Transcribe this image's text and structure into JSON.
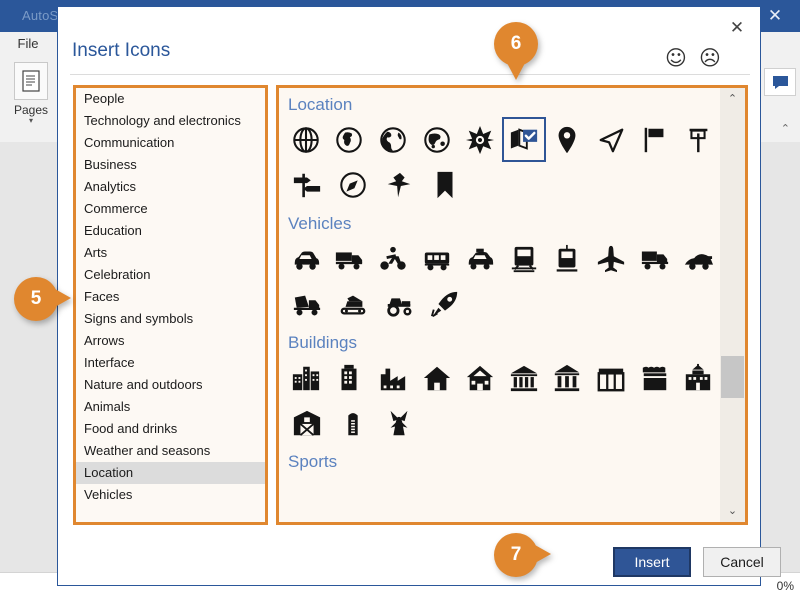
{
  "app": {
    "autosave_label": "AutoSave",
    "file_tab": "File",
    "pages_label": "Pages",
    "pages_caret": "▾",
    "close_icon": "✕",
    "comment_icon": "comment-icon",
    "collapse_caret": "⌃",
    "zoom_level": "0%"
  },
  "dialog": {
    "title": "Insert Icons",
    "close_icon": "✕",
    "feedback_happy": "☺",
    "feedback_sad": "☹"
  },
  "categories": {
    "selected": "Location",
    "items": [
      "People",
      "Technology and electronics",
      "Communication",
      "Business",
      "Analytics",
      "Commerce",
      "Education",
      "Arts",
      "Celebration",
      "Faces",
      "Signs and symbols",
      "Arrows",
      "Interface",
      "Nature and outdoors",
      "Animals",
      "Food and drinks",
      "Weather and seasons",
      "Location",
      "Vehicles"
    ]
  },
  "icon_panel": {
    "scroll_up_icon": "⌃",
    "scroll_down_icon": "⌄",
    "groups": [
      {
        "title": "Location",
        "icons": [
          "globe-wireframe-icon",
          "globe-africa-icon",
          "globe-americas-icon",
          "globe-asia-icon",
          "compass-rose-icon",
          "folded-map-check-icon",
          "map-pin-icon",
          "navigation-arrow-icon",
          "flag-icon",
          "signpost-icon",
          "direction-sign-icon",
          "compass-icon",
          "push-pin-icon",
          "bookmark-icon"
        ],
        "selected_index": 5
      },
      {
        "title": "Vehicles",
        "icons": [
          "car-icon",
          "tanker-truck-icon",
          "motorcycle-icon",
          "bus-icon",
          "taxi-icon",
          "train-icon",
          "tram-icon",
          "airplane-icon",
          "dump-truck-icon",
          "race-car-icon",
          "cement-mixer-icon",
          "excavator-icon",
          "tractor-icon",
          "rocket-icon"
        ],
        "selected_index": -1
      },
      {
        "title": "Buildings",
        "icons": [
          "city-skyline-icon",
          "office-building-icon",
          "factory-icon",
          "house-icon",
          "home-gable-icon",
          "bank-icon",
          "museum-icon",
          "storefront-icon",
          "market-stall-icon",
          "school-icon",
          "barn-icon",
          "silo-icon",
          "windmill-icon"
        ],
        "selected_index": -1
      },
      {
        "title": "Sports",
        "icons": [],
        "selected_index": -1
      }
    ]
  },
  "footer": {
    "insert_label": "Insert",
    "cancel_label": "Cancel"
  },
  "callouts": [
    {
      "id": "5",
      "label": "5"
    },
    {
      "id": "6",
      "label": "6"
    },
    {
      "id": "7",
      "label": "7"
    }
  ],
  "colors": {
    "accent_orange": "#e0872f",
    "office_blue": "#2b579a",
    "button_blue": "#2f5596",
    "group_title_blue": "#5b82bf",
    "panel_bg": "#fdf8f2"
  }
}
